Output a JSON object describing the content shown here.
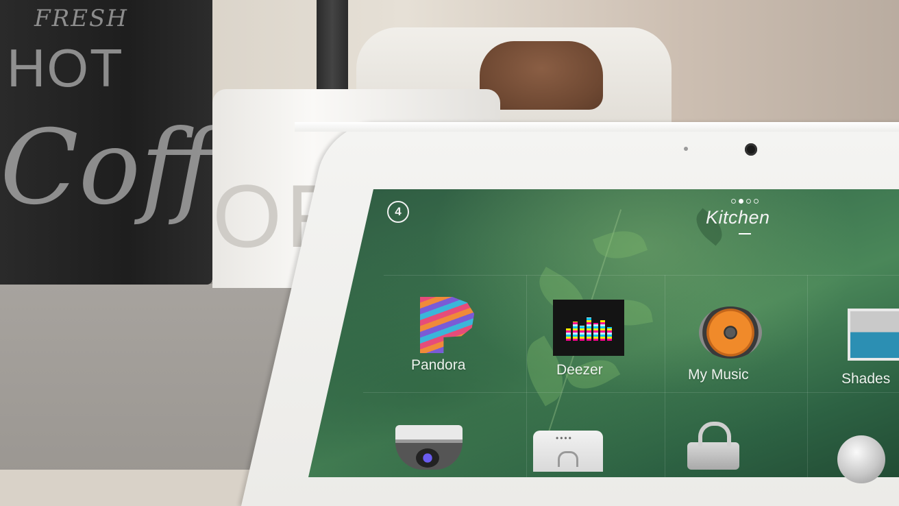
{
  "room": {
    "title": "Kitchen",
    "pages": 4,
    "active_page": 2
  },
  "header": {
    "logo_glyph": "4",
    "logo_icon": "control4-logo-icon"
  },
  "tiles": [
    {
      "label": "Pandora",
      "icon": "pandora-icon"
    },
    {
      "label": "Deezer",
      "icon": "deezer-icon"
    },
    {
      "label": "My Music",
      "icon": "speaker-icon"
    },
    {
      "label": "Shades",
      "icon": "shades-icon"
    },
    {
      "label": "",
      "icon": "security-camera-icon"
    },
    {
      "label": "",
      "icon": "keypad-unlock-icon"
    },
    {
      "label": "",
      "icon": "lock-icon"
    },
    {
      "label": "",
      "icon": "light-icon"
    }
  ],
  "background_photo": {
    "mug_lettering": [
      "FRESH",
      "HOT",
      "Coffee"
    ],
    "cup_lettering": "OFF"
  },
  "colors": {
    "screen_green": "#3d7550",
    "label_text": "#eef3ee"
  }
}
